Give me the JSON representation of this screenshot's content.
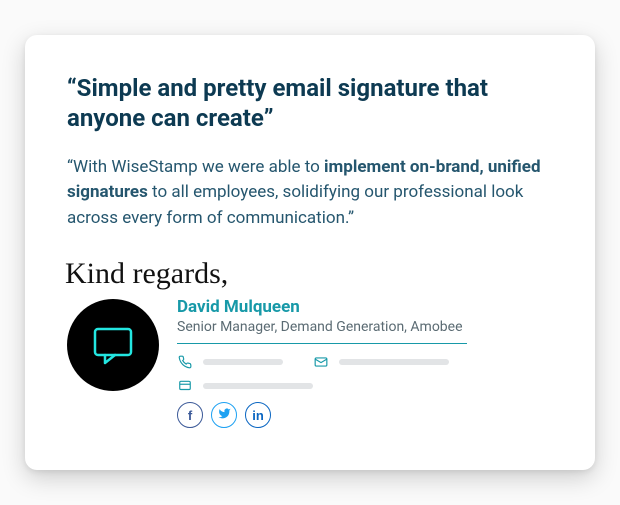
{
  "headline": "“Simple and pretty email signature that anyone can create”",
  "quote_prefix": "“With WiseStamp we were able to ",
  "quote_bold": "implement on-brand, unified signatures",
  "quote_suffix": " to all employees, solidifying our professional look across every form of communication.”",
  "signoff": "Kind regards,",
  "signer_name": "David Mulqueen",
  "signer_title": "Senior Manager, Demand Generation, Amobee",
  "avatar_icon_name": "chat-bubble-icon",
  "avatar_ring_color": "#23e6e1",
  "socials": {
    "facebook_label": "f",
    "twitter_label": "twitter",
    "linkedin_label": "in"
  },
  "contact_icons": {
    "phone": "phone-icon",
    "email": "email-icon",
    "website": "website-icon"
  }
}
